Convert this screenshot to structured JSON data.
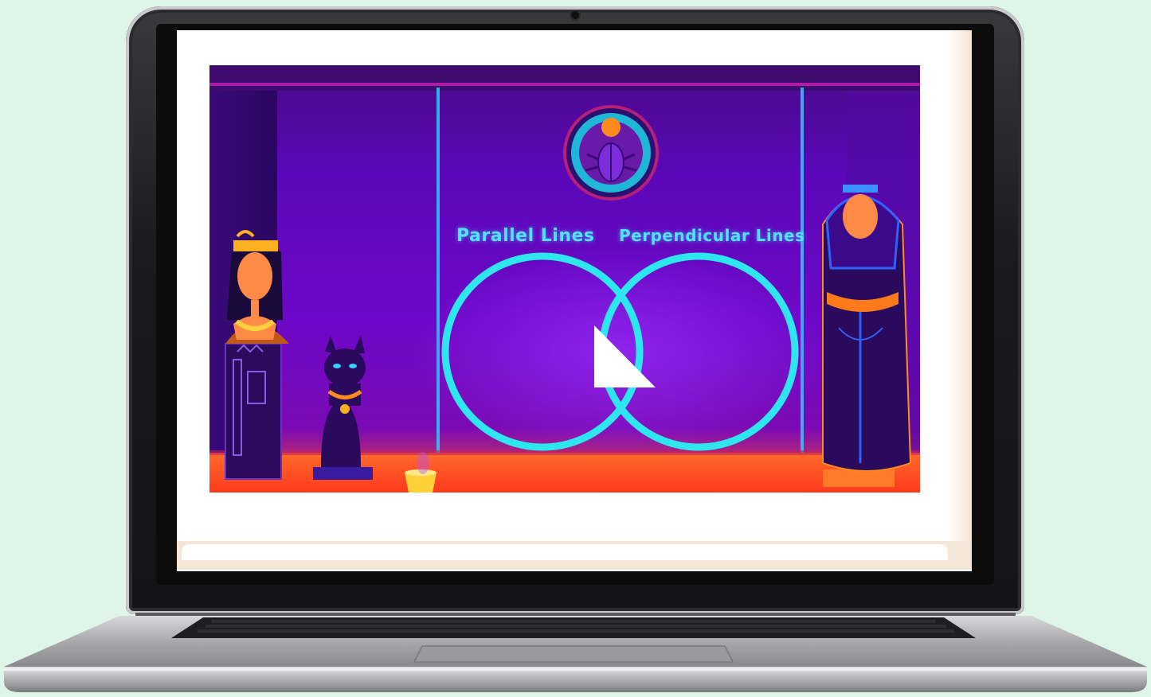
{
  "slide": {
    "labels": {
      "left": "Parallel Lines",
      "right": "Perpendicular Lines"
    },
    "draggable_item": "right-triangle-shape",
    "emblem": "scarab-icon"
  },
  "colors": {
    "background": "#dff5ea",
    "venn_ring": "#2ee6ee",
    "label": "#4fe3ff",
    "slide_top": "#4a0a86",
    "slide_floor": "#ff4f2a"
  }
}
